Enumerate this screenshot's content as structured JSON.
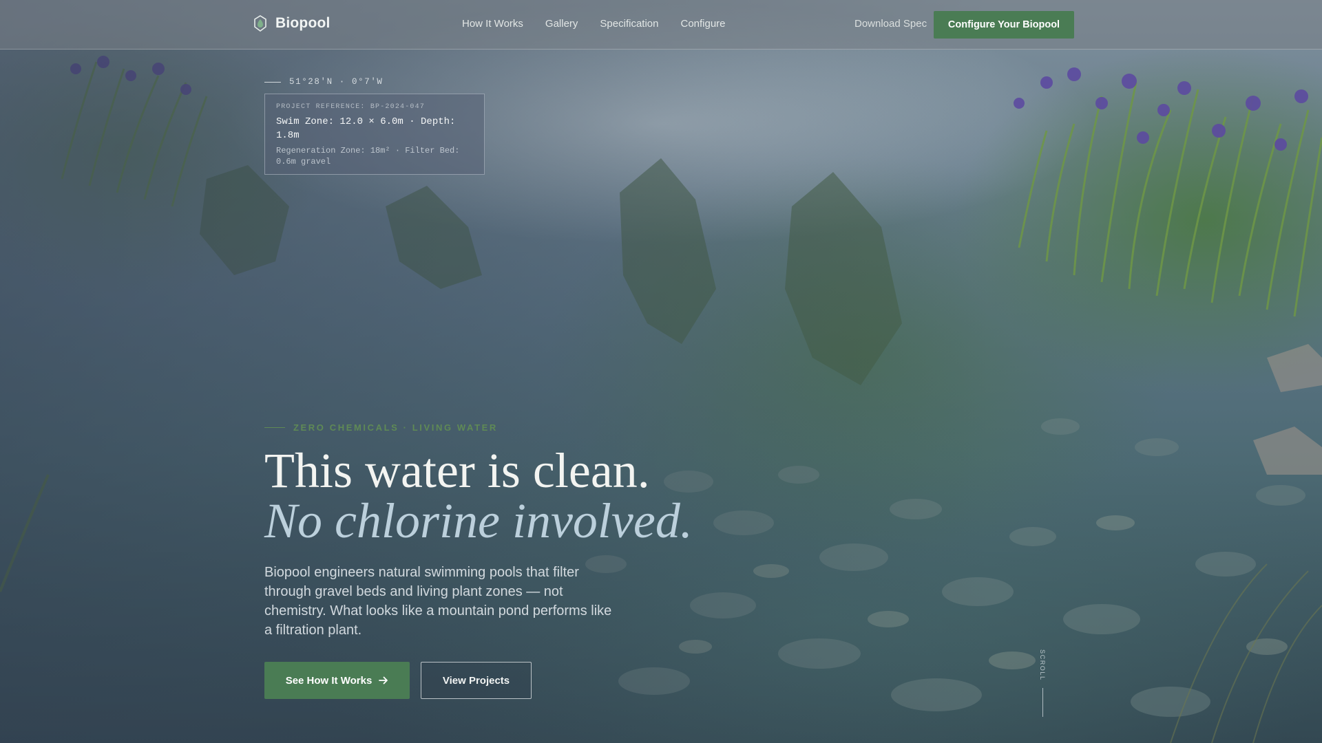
{
  "brand": {
    "name": "Biopool",
    "logo_icon": "leaf-drop-icon"
  },
  "nav": {
    "links": [
      {
        "label": "How It Works"
      },
      {
        "label": "Gallery"
      },
      {
        "label": "Specification"
      },
      {
        "label": "Configure"
      }
    ],
    "download_label": "Download Spec",
    "cta_label": "Configure Your Biopool"
  },
  "project": {
    "coordinates": "51°28'N · 0°7'W",
    "reference_label": "PROJECT REFERENCE: BP-2024-047",
    "main_spec": "Swim Zone: 12.0 × 6.0m · Depth: 1.8m",
    "sub_spec": "Regeneration Zone: 18m² · Filter Bed: 0.6m gravel"
  },
  "hero": {
    "eyebrow": "ZERO CHEMICALS · LIVING WATER",
    "headline_line1": "This water is clean.",
    "headline_line2": "No chlorine involved.",
    "lede": "Biopool engineers natural swimming pools that filter through gravel beds and living plant zones — not chemistry. What looks like a mountain pond performs like a filtration plant.",
    "primary_cta": "See How It Works",
    "primary_cta_icon": "arrow-right-icon",
    "secondary_cta": "View Projects",
    "scroll_label": "SCROLL"
  },
  "colors": {
    "accent_green": "#4a7c54",
    "eyebrow_green": "#5f8a55",
    "headline_italic": "#bcd0dc"
  }
}
